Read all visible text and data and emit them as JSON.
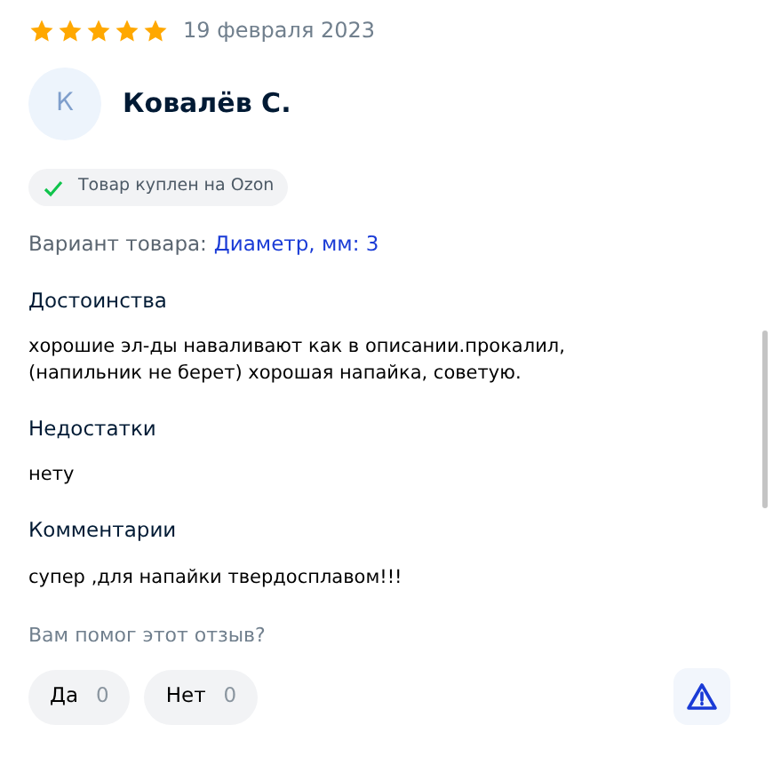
{
  "review": {
    "stars": 5,
    "date": "19 февраля 2023"
  },
  "author": {
    "initial": "К",
    "name": "Ковалёв С."
  },
  "badge": {
    "text": "Товар куплен на Ozon",
    "verified": true
  },
  "variant": {
    "label": "Вариант товара:",
    "value": "Диаметр, мм: 3"
  },
  "sections": [
    {
      "title": "Достоинства",
      "text": "хорошие эл-ды наваливают как в описании.прокалил,\n(напильник не берет) хорошая напайка, советую."
    },
    {
      "title": "Недостатки",
      "text": "нету"
    },
    {
      "title": "Комментарии",
      "text": "супер ,для напайки твердосплавом!!!"
    }
  ],
  "helpful": {
    "question": "Вам помог этот отзыв?",
    "buttons": [
      {
        "label": "Да",
        "count": "0"
      },
      {
        "label": "Нет",
        "count": "0"
      }
    ]
  }
}
